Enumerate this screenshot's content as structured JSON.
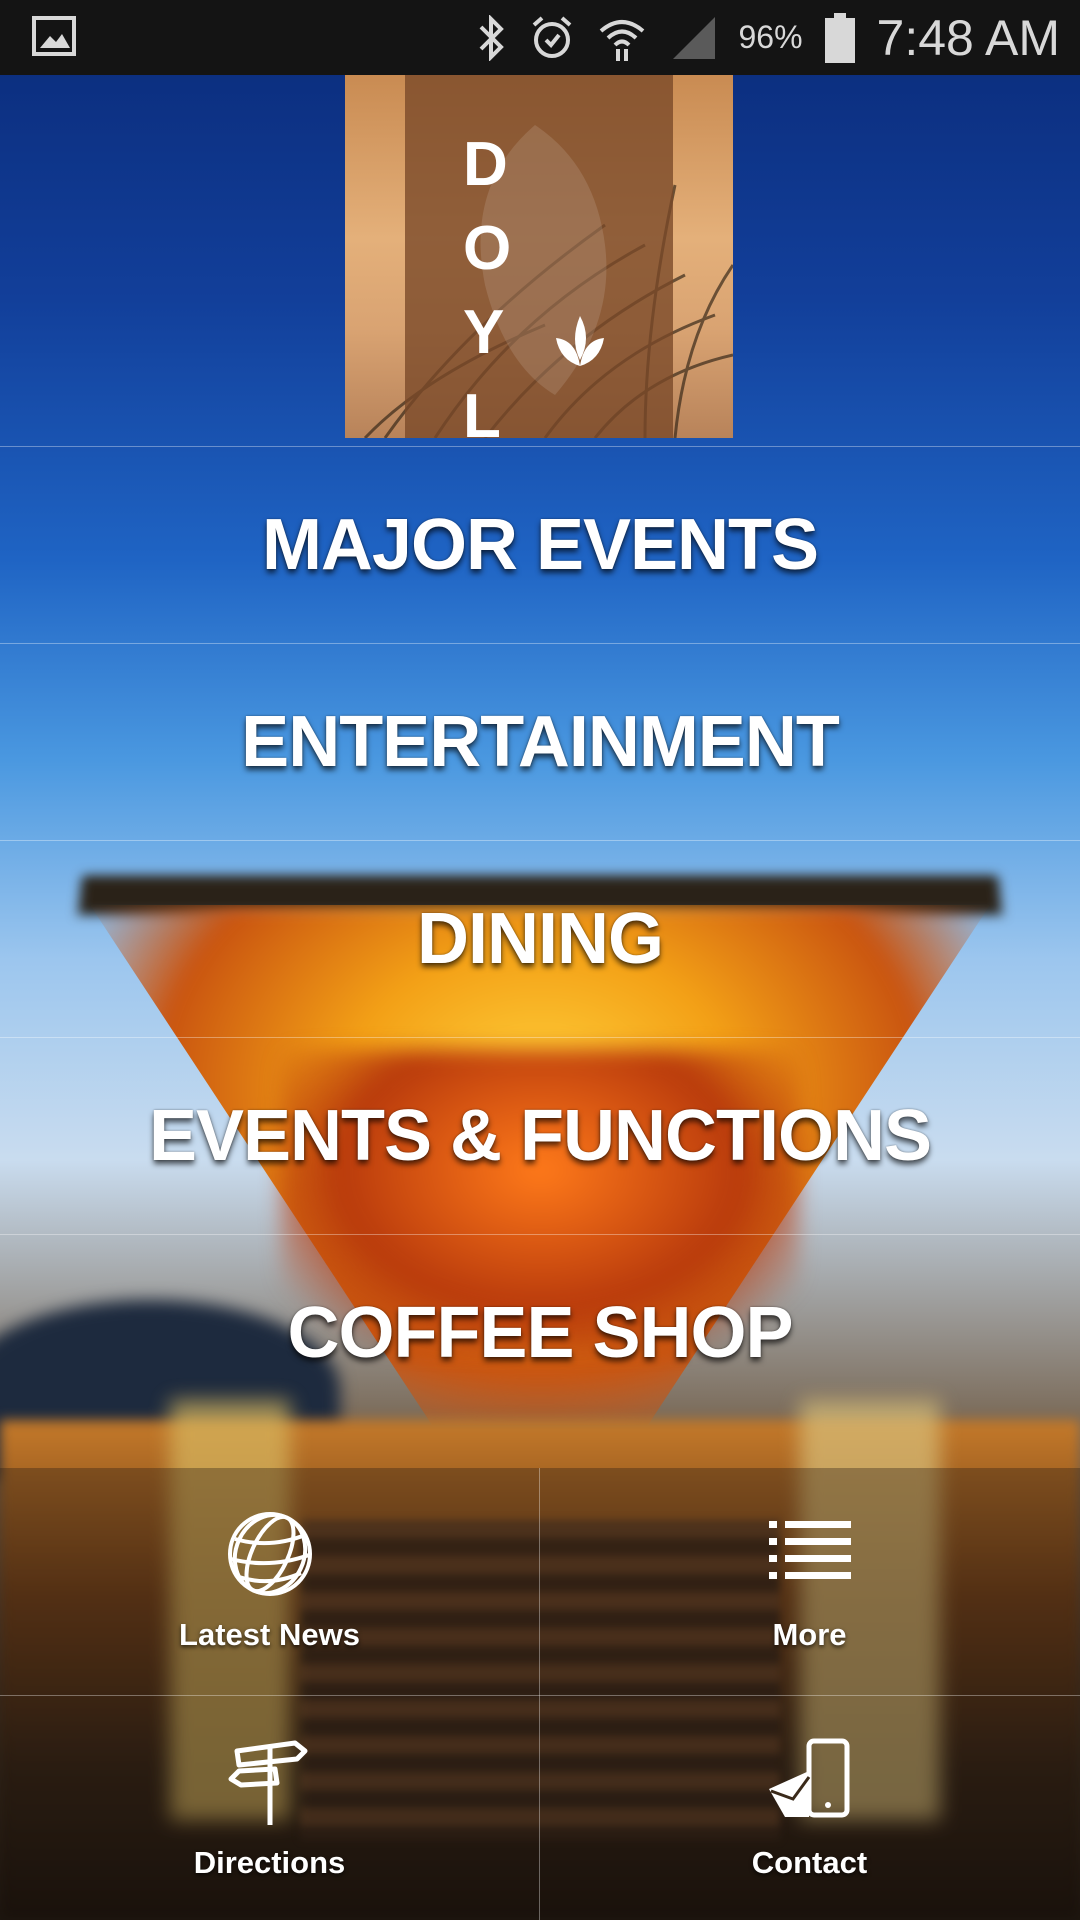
{
  "status_bar": {
    "notification_icon": "gallery-icon",
    "icons": [
      "bluetooth-icon",
      "alarm-icon",
      "wifi-icon",
      "signal-icon",
      "battery-icon"
    ],
    "battery_percent": "96%",
    "time": "7:48 AM"
  },
  "logo": {
    "letters": "D O Y L O",
    "leaf_icon": "leaf-icon"
  },
  "menu": {
    "items": [
      {
        "label": "MAJOR EVENTS"
      },
      {
        "label": "ENTERTAINMENT"
      },
      {
        "label": "DINING"
      },
      {
        "label": "EVENTS & FUNCTIONS"
      },
      {
        "label": "COFFEE SHOP"
      }
    ]
  },
  "bottom_nav": {
    "items": [
      {
        "label": "Latest News",
        "icon": "globe-icon"
      },
      {
        "label": "More",
        "icon": "list-icon"
      },
      {
        "label": "Directions",
        "icon": "signpost-icon"
      },
      {
        "label": "Contact",
        "icon": "phone-message-icon"
      }
    ]
  }
}
